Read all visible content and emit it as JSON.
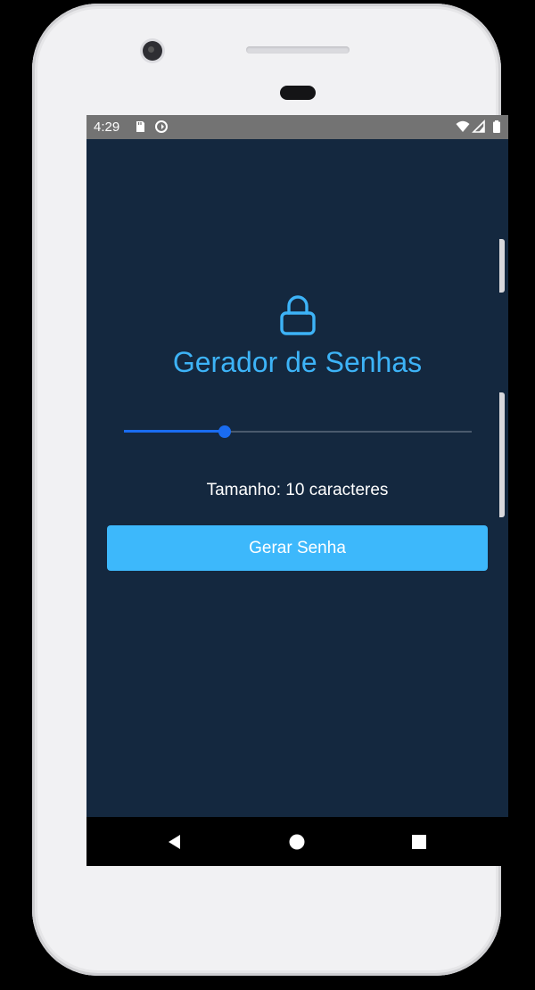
{
  "status_bar": {
    "time": "4:29",
    "icons": [
      "sd-card-icon",
      "sync-icon",
      "wifi-icon",
      "signal-icon",
      "battery-icon"
    ]
  },
  "app": {
    "icon": "lock-icon",
    "title": "Gerador de Senhas",
    "slider": {
      "value": 10,
      "min": 4,
      "max": 32,
      "fraction": 0.29
    },
    "length_label": "Tamanho: 10 caracteres",
    "button_label": "Gerar Senha",
    "colors": {
      "background": "#14283f",
      "accent": "#3db3f7",
      "button": "#3db8fb",
      "slider": "#1a6cf0"
    }
  },
  "nav_bar": {
    "buttons": [
      "back-icon",
      "home-icon",
      "recents-icon"
    ]
  }
}
